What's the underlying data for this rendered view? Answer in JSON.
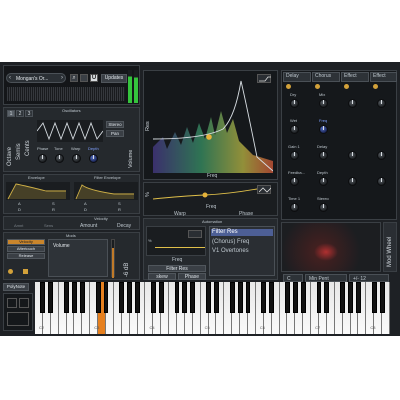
{
  "preset": {
    "name": "Mongan's Or...",
    "updates_label": "Updates"
  },
  "oscillators": {
    "title": "Oscillators",
    "tabs": [
      "1",
      "2",
      "3"
    ],
    "stereo_label": "Stereo",
    "pan_label": "Pan",
    "knobs": [
      "Phase",
      "Tone",
      "Warp",
      "Depth"
    ],
    "volume_label": "Volume",
    "side_labels": [
      "Octave",
      "Semis",
      "Cents"
    ]
  },
  "envelope": {
    "title": "Envelope",
    "filter_title": "Filter Envelope",
    "labels_left": [
      "A",
      "S",
      "D",
      "R"
    ],
    "labels_right": [
      "A",
      "S",
      "D",
      "R"
    ]
  },
  "velocity": {
    "title": "Velocity",
    "amount_label": "Amount",
    "decay_label": "Decay",
    "left_labels": [
      "Amnt",
      "Sens"
    ]
  },
  "mods": {
    "title": "Mods",
    "buttons": [
      "Velocity",
      "Aftertouch",
      "Release"
    ],
    "target": "Volume",
    "level_label": "-6 dB"
  },
  "filter_display": {
    "res_label": "Res",
    "freq_label": "Freq"
  },
  "lfo": {
    "freq_label": "Freq",
    "warp_label": "Warp",
    "phase_label": "Phase"
  },
  "automation": {
    "title": "Automation",
    "freq_label": "Freq",
    "filter_res_label": "Filter Res",
    "skew_label": "skew",
    "phase_label": "Phase",
    "list": [
      "Filter Res",
      "(Chorus) Freq",
      "V1 Overtones"
    ]
  },
  "effects": {
    "slots": [
      "Delay",
      "Chorus",
      "Effect",
      "Effect"
    ],
    "delay_knobs": [
      "Dry",
      "Wet",
      "Gain 1",
      "Feedba...",
      "Time 1"
    ],
    "chorus_knobs": [
      "Mix",
      "Freq",
      "Delay",
      "Depth",
      "Stereo"
    ]
  },
  "mod_wheel": {
    "label": "Mod Wheel"
  },
  "scale": {
    "key": "C",
    "mode": "Min Pent",
    "range": "+/- 12"
  },
  "poly_label": "PolyNote",
  "keyboard": {
    "octave_labels": [
      "C2",
      "C3",
      "C4",
      "C5",
      "C6",
      "C7",
      "C8"
    ]
  }
}
